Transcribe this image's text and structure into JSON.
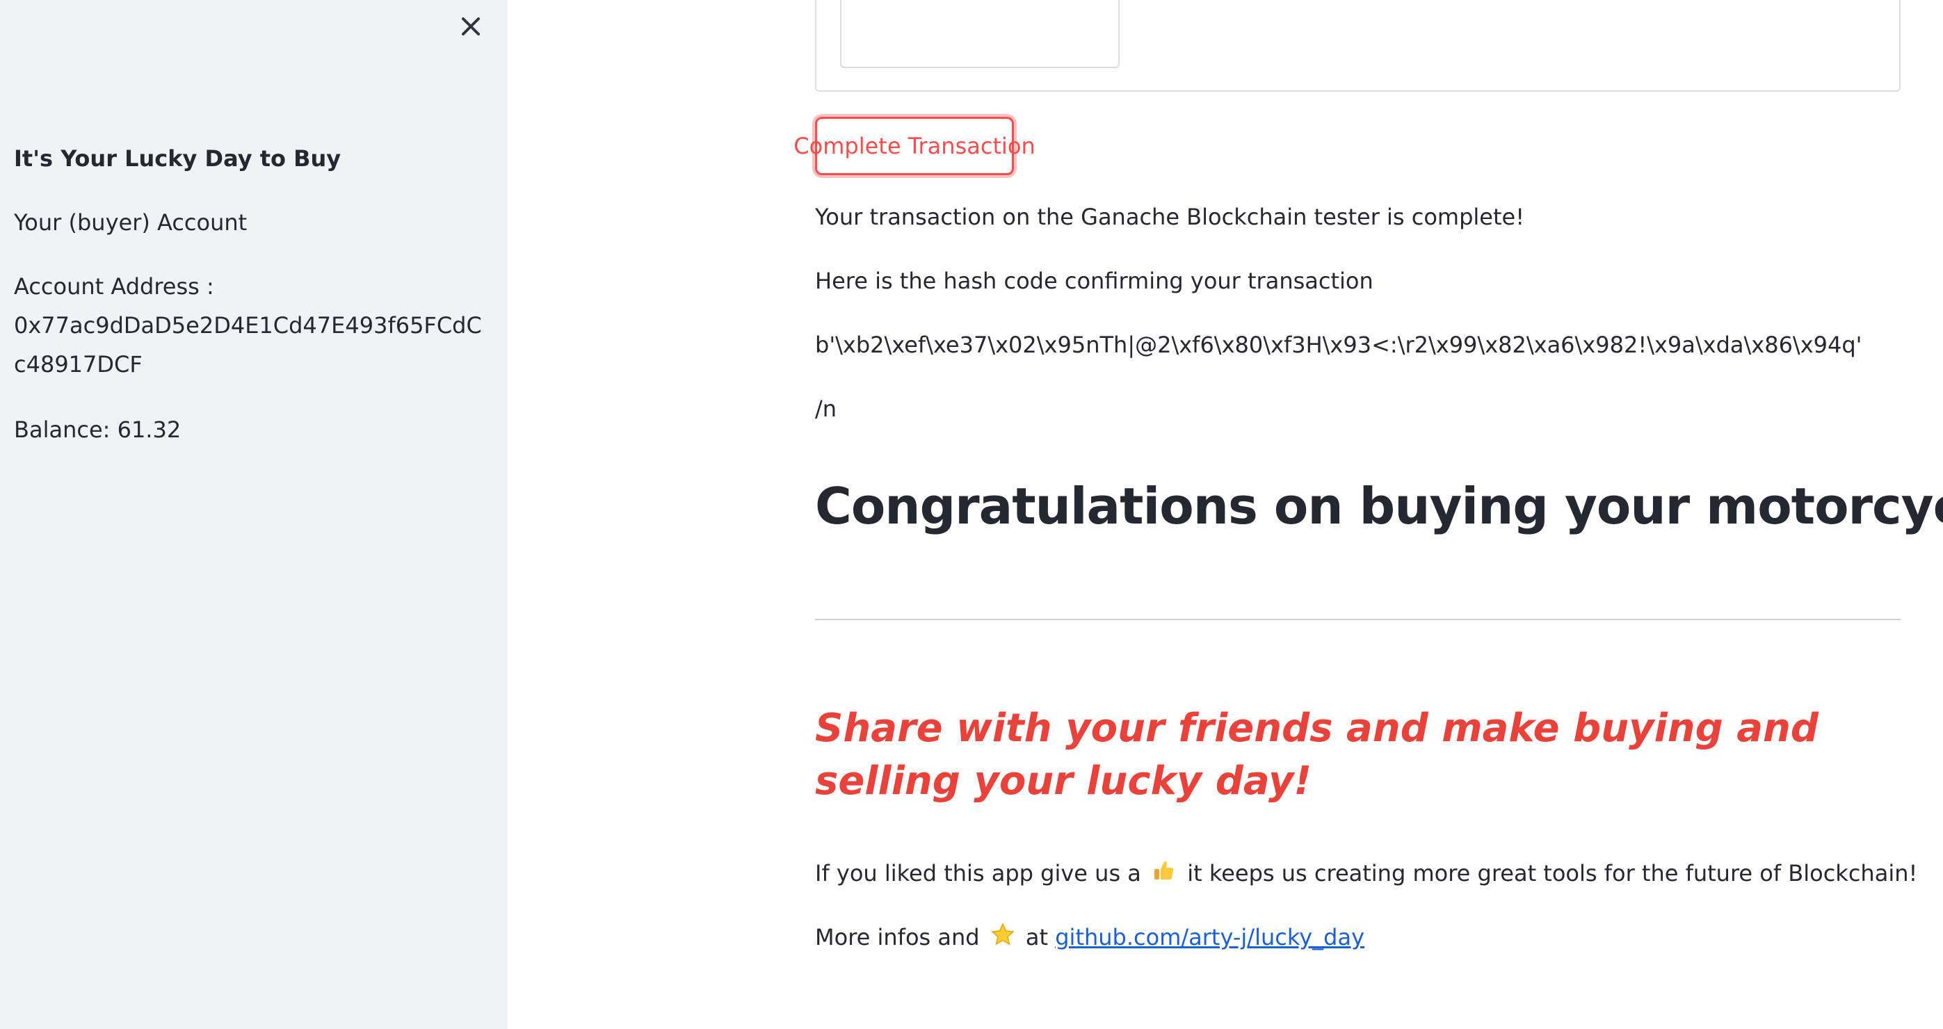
{
  "sidebar": {
    "title": "It's Your Lucky Day to Buy",
    "account_label": "Your (buyer) Account",
    "address_label": "Account Address :",
    "address": "0x77ac9dDaD5e2D4E1Cd47E493f65FCdCc48917DCF",
    "balance": "Balance: 61.32"
  },
  "main": {
    "complete_button": "Complete Transaction",
    "status": "Your transaction on the Ganache Blockchain tester is complete!",
    "hash_intro": "Here is the hash code confirming your transaction",
    "hash_code": "b'\\xb2\\xef\\xe37\\x02\\x95nTh|@2\\xf6\\x80\\xf3H\\x93<:\\r2\\x99\\x82\\xa6\\x982!\\x9a\\xda\\x86\\x94q'",
    "newline_text": "/n",
    "heading": "Congratulations on buying your motorcycle!",
    "share_text": "Share with your friends and make buying and selling your lucky day!",
    "like_before": "If you liked this app give us a",
    "like_after": "it keeps us creating more great tools for the future of Blockchain!",
    "infos_before": "More infos and",
    "infos_at": "at",
    "link_text": "github.com/arty-j/lucky_day"
  },
  "icons": {
    "close": "close-icon",
    "thumbs_up": "thumbs-up-icon",
    "star": "star-icon"
  },
  "colors": {
    "sidebar_bg": "#f0f2f6",
    "accent_red": "#ff4b4b",
    "share_red": "#e8423a",
    "link_blue": "#1a5fd6",
    "text": "#262730"
  }
}
